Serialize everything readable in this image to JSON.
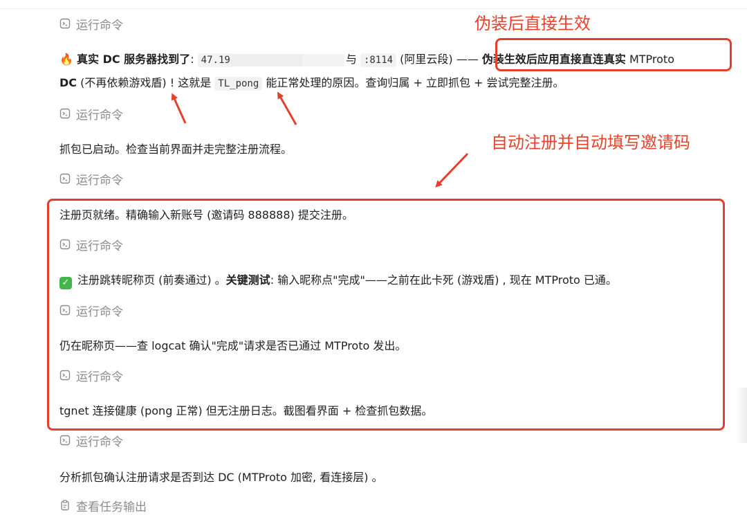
{
  "commands": {
    "run_label": "运行命令",
    "output_label": "查看任务输出"
  },
  "messages": {
    "m1": {
      "emoji": "🔥",
      "bold": "真实 DC 服务器找到了",
      "colon": ": ",
      "ip_code": "47.1",
      "ip_partial": "9",
      "and": "与",
      "port_code": ":8114",
      "suffix": " (阿里云段) ——",
      "bold2": "伪装生效后应用直接直连真实",
      "mt": " MTProto",
      "line2_bold": "DC",
      "line2_a": " (不再依赖游戏盾) ! 这就是 ",
      "line2_code": "TL_pong",
      "line2_b": " 能正常处理的原因。查询归属 + 立即抓包 + 尝试完整注册。"
    },
    "m2": "抓包已启动。检查当前界面并走完整注册流程。",
    "m3": "注册页就绪。精确输入新账号 (邀请码 888888) 提交注册。",
    "m4": {
      "a": "注册跳转昵称页 (前奏通过) 。",
      "bold": "关键测试",
      "b": ": 输入昵称点\"完成\"——之前在此卡死 (游戏盾) , 现在 MTProto 已通。"
    },
    "m5": "仍在昵称页——查 logcat 确认\"完成\"请求是否已通过 MTProto 发出。",
    "m6": "tgnet 连接健康 (pong 正常) 但无注册日志。截图看界面 + 检查抓包数据。",
    "m7": "分析抓包确认注册请求是否到达 DC (MTProto 加密, 看连接层) 。"
  },
  "annotations": {
    "a1": "伪装后直接生效",
    "a2": "自动注册并自动填写邀请码"
  },
  "colors": {
    "annotation_red": "#e8412c",
    "muted_gray": "#8c8c8c",
    "check_green": "#44b549"
  },
  "icons": {
    "command": "terminal-icon",
    "output": "clipboard-icon",
    "check": "check-mark-icon",
    "fire": "fire-emoji"
  }
}
